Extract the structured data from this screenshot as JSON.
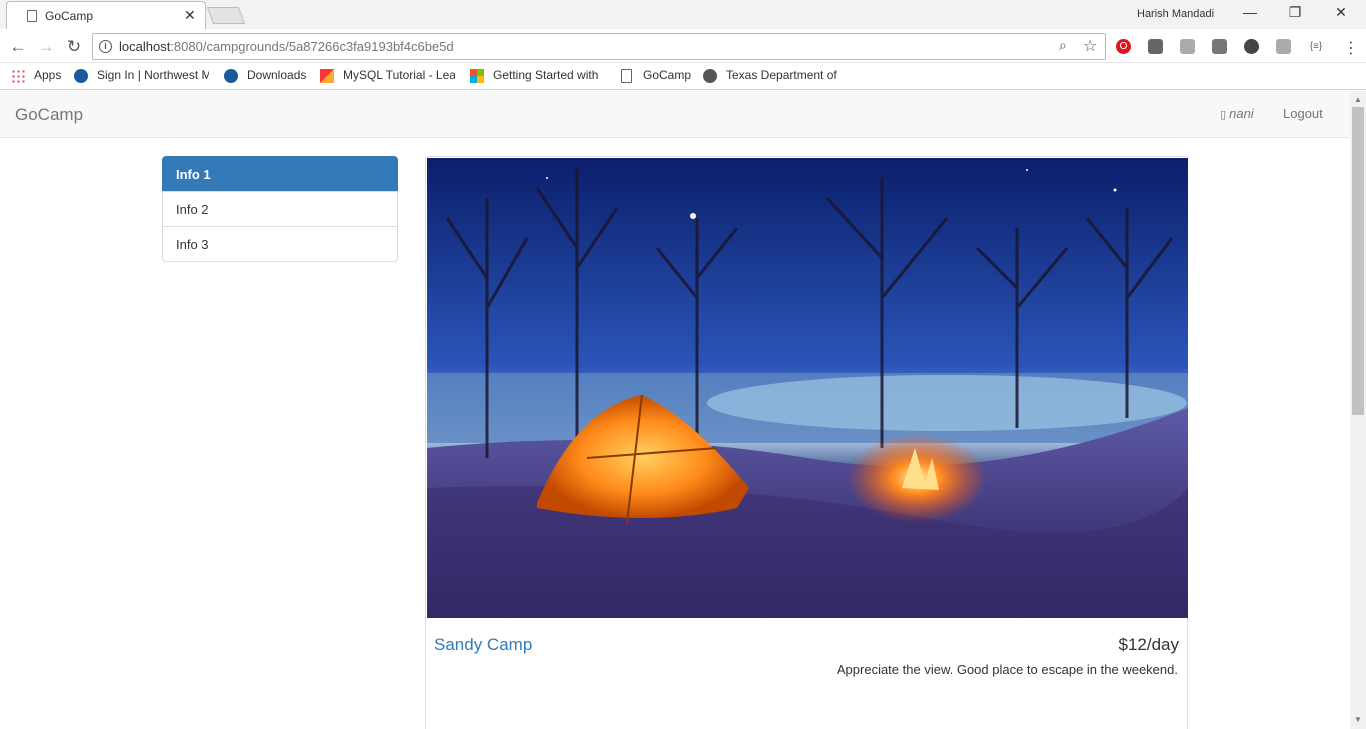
{
  "browser": {
    "tab_title": "GoCamp",
    "profile_name": "Harish Mandadi",
    "url_host": "localhost",
    "url_path": ":8080/campgrounds/5a87266c3fa9193bf4c6be5d",
    "bookmarks": [
      {
        "label": "Apps"
      },
      {
        "label": "Sign In | Northwest M"
      },
      {
        "label": "Downloads"
      },
      {
        "label": "MySQL Tutorial - Lea"
      },
      {
        "label": "Getting Started with"
      },
      {
        "label": "GoCamp"
      },
      {
        "label": "Texas Department of"
      }
    ]
  },
  "site": {
    "brand": "GoCamp",
    "user": "nani",
    "logout": "Logout"
  },
  "sidebar": {
    "items": [
      {
        "label": "Info 1",
        "active": true
      },
      {
        "label": "Info 2",
        "active": false
      },
      {
        "label": "Info 3",
        "active": false
      }
    ]
  },
  "campground": {
    "name": "Sandy Camp",
    "price": "$12/day",
    "description": "Appreciate the view. Good place to escape in the weekend."
  },
  "colors": {
    "primary": "#337ab7",
    "navbar_bg": "#f8f8f8"
  }
}
